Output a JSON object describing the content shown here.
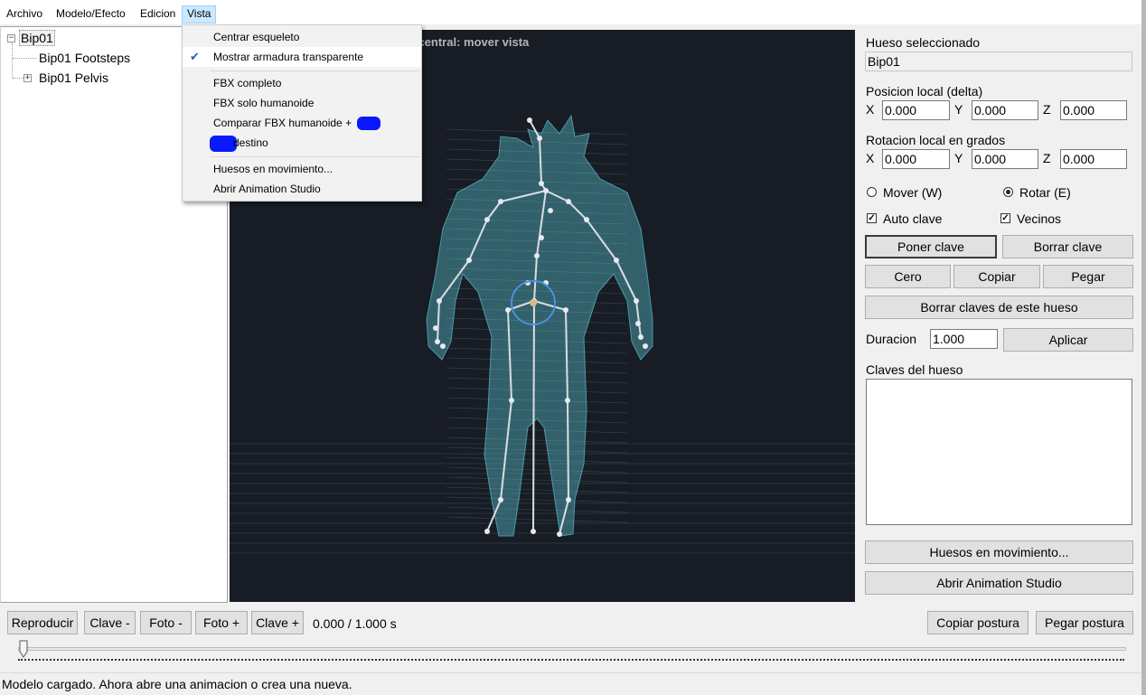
{
  "menubar": {
    "items": [
      "Archivo",
      "Modelo/Efecto",
      "Edicion",
      "Vista"
    ],
    "active": "Vista"
  },
  "vista_menu": {
    "items": [
      {
        "label": "Centrar esqueleto",
        "checked": false
      },
      {
        "label": "Mostrar armadura transparente",
        "checked": true
      },
      {
        "label": "FBX completo",
        "checked": false
      },
      {
        "label": "FBX solo humanoide",
        "checked": false
      },
      {
        "label": "Comparar FBX humanoide +",
        "checked": false
      },
      {
        "label": "destino",
        "checked": false
      },
      {
        "label": "Huesos en movimiento...",
        "checked": false
      },
      {
        "label": "Abrir Animation Studio",
        "checked": false
      }
    ],
    "check_glyph": "✔"
  },
  "tree": {
    "root": {
      "label": "Bip01",
      "expander": "−"
    },
    "children": [
      {
        "label": "Bip01 Footsteps"
      },
      {
        "label": "Bip01 Pelvis",
        "expander": "+"
      }
    ]
  },
  "viewport": {
    "hint": "Boton derecho: rotar camara | Boton central: mover vista",
    "background": "#181c24",
    "mesh_color": "#4a9aa6"
  },
  "panel": {
    "selected_bone_label": "Hueso seleccionado",
    "selected_bone_value": "Bip01",
    "position_label": "Posicion local (delta)",
    "position": {
      "x_label": "X",
      "y_label": "Y",
      "z_label": "Z",
      "x": "0.000",
      "y": "0.000",
      "z": "0.000"
    },
    "rotation_label": "Rotacion local en grados",
    "rotation": {
      "x_label": "X",
      "y_label": "Y",
      "z_label": "Z",
      "x": "0.000",
      "y": "0.000",
      "z": "0.000"
    },
    "mode_move": "Mover (W)",
    "mode_rotate": "Rotar (E)",
    "mode_selected": "rotate",
    "auto_key": "Auto clave",
    "neighbors": "Vecinos",
    "auto_key_checked": true,
    "neighbors_checked": true,
    "set_key": "Poner clave",
    "delete_key": "Borrar clave",
    "zero": "Cero",
    "copy": "Copiar",
    "paste": "Pegar",
    "delete_bone_keys": "Borrar claves de este hueso",
    "duration_label": "Duracion",
    "duration_value": "1.000",
    "apply": "Aplicar",
    "bone_keys_label": "Claves del hueso",
    "moving_bones": "Huesos en movimiento...",
    "open_studio": "Abrir Animation Studio"
  },
  "bottom": {
    "play": "Reproducir",
    "key_prev": "Clave -",
    "frame_prev": "Foto -",
    "frame_next": "Foto +",
    "key_next": "Clave +",
    "time": "0.000 / 1.000 s",
    "copy_pose": "Copiar postura",
    "paste_pose": "Pegar postura",
    "timeline_position": 0.0
  },
  "status": "Modelo cargado. Ahora abre una animacion o crea una nueva."
}
